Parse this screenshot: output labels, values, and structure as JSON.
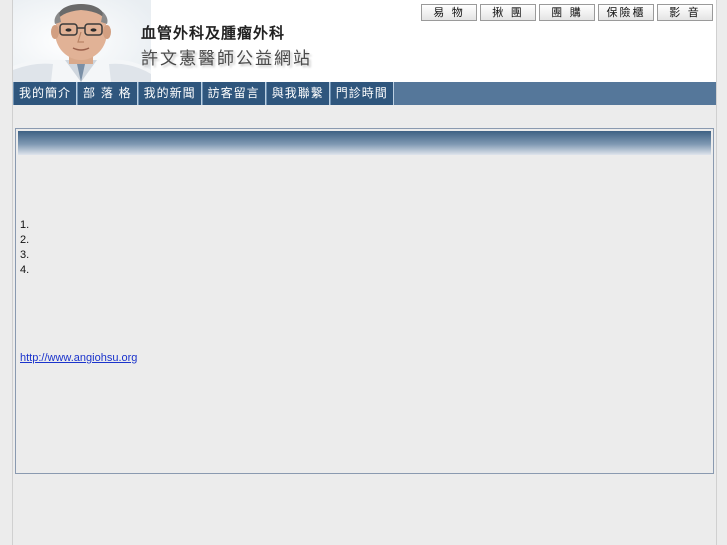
{
  "header": {
    "title_line1": "血管外科及腫瘤外科",
    "title_line2": "許文憲醫師公益網站",
    "top_links": [
      {
        "label": "易 物",
        "icon": "none"
      },
      {
        "label": "揪 團",
        "icon": "none"
      },
      {
        "label": "團 購",
        "icon": "none"
      },
      {
        "label": "保險櫃",
        "icon": "none"
      },
      {
        "label": "影 音",
        "icon": "none"
      }
    ]
  },
  "nav": {
    "items": [
      {
        "label": "我的簡介"
      },
      {
        "label": "部 落 格"
      },
      {
        "label": "我的新聞"
      },
      {
        "label": "訪客留言"
      },
      {
        "label": "與我聯繫"
      },
      {
        "label": "門診時間"
      }
    ]
  },
  "content": {
    "list": [
      "1.",
      "2.",
      "3.",
      "4."
    ],
    "link_text": "http://www.angiohsu.org"
  },
  "colors": {
    "nav_bg": "#2f567d",
    "nav_bar": "#55779a",
    "page_bg": "#ececec",
    "link": "#1a33cc"
  }
}
